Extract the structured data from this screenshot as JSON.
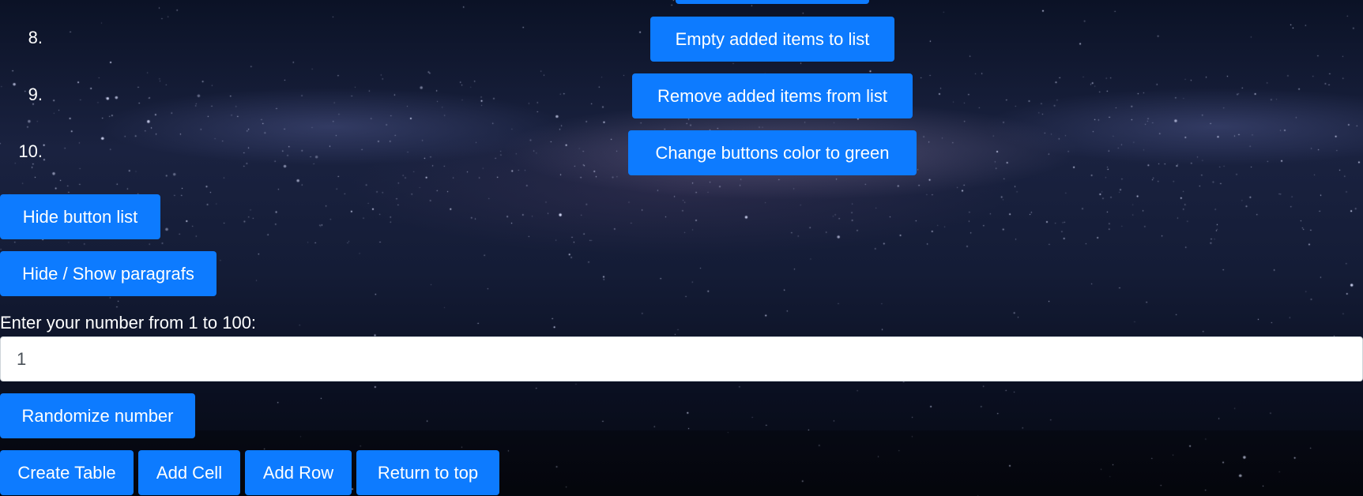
{
  "ordered_list": {
    "numbers": [
      "8.",
      "9.",
      "10."
    ]
  },
  "center_buttons": {
    "empty_added_items": "Empty added items to list",
    "remove_added_items": "Remove added items from list",
    "change_color_green": "Change buttons color to green"
  },
  "left_buttons": {
    "hide_button_list": "Hide button list",
    "hide_show_paragrafs": "Hide / Show paragrafs"
  },
  "number_entry": {
    "label": "Enter your number from 1 to 100:",
    "value": "1",
    "randomize_label": "Randomize number"
  },
  "table_controls": {
    "create_table": "Create Table",
    "add_cell": "Add Cell",
    "add_row": "Add Row",
    "return_to_top": "Return to top"
  },
  "colors": {
    "button_blue": "#0d7bff",
    "background_dark": "#0b1226"
  }
}
